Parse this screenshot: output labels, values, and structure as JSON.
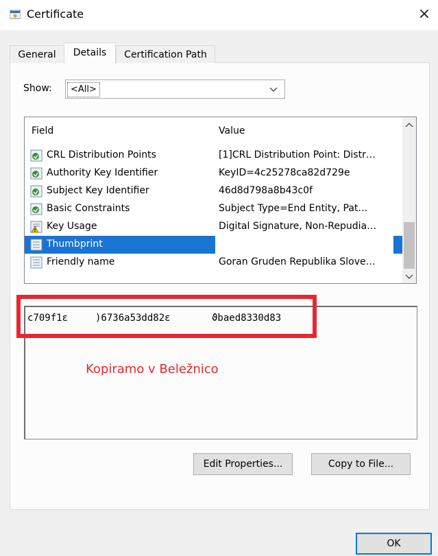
{
  "window": {
    "title": "Certificate",
    "close_glyph": "×"
  },
  "tabs": [
    {
      "label": "General",
      "active": false
    },
    {
      "label": "Details",
      "active": true
    },
    {
      "label": "Certification Path",
      "active": false
    }
  ],
  "show": {
    "label": "Show:",
    "selected": "<All>"
  },
  "list": {
    "headers": {
      "field": "Field",
      "value": "Value"
    },
    "rows": [
      {
        "field": "CRL Distribution Points",
        "value": "[1]CRL Distribution Point: Distr…",
        "icon": "extension-icon"
      },
      {
        "field": "Authority Key Identifier",
        "value": "KeyID=4c25278ca82d729e",
        "icon": "extension-icon"
      },
      {
        "field": "Subject Key Identifier",
        "value": "46d8d798a8b43c0f",
        "icon": "extension-icon"
      },
      {
        "field": "Basic Constraints",
        "value": "Subject Type=End Entity, Pat…",
        "icon": "extension-icon"
      },
      {
        "field": "Key Usage",
        "value": "Digital Signature, Non-Repudia…",
        "icon": "warning-extension-icon"
      },
      {
        "field": "Thumbprint",
        "value": "",
        "icon": "property-icon",
        "selected": true
      },
      {
        "field": "Friendly name",
        "value": "Goran Gruden Republika Slove…",
        "icon": "property-icon"
      }
    ]
  },
  "detail": {
    "thumbprint_segments": [
      "c709f1ε",
      ")6736a53dd82ε",
      "ϑbaed8330d83"
    ]
  },
  "annotation": "Kopiramo v Beležnico",
  "buttons": {
    "edit_properties": "Edit Properties...",
    "copy_to_file": "Copy to File...",
    "ok": "OK"
  },
  "colors": {
    "selection": "#1a74d3",
    "annotation_red": "#e8262f",
    "ok_border": "#0078d7"
  }
}
